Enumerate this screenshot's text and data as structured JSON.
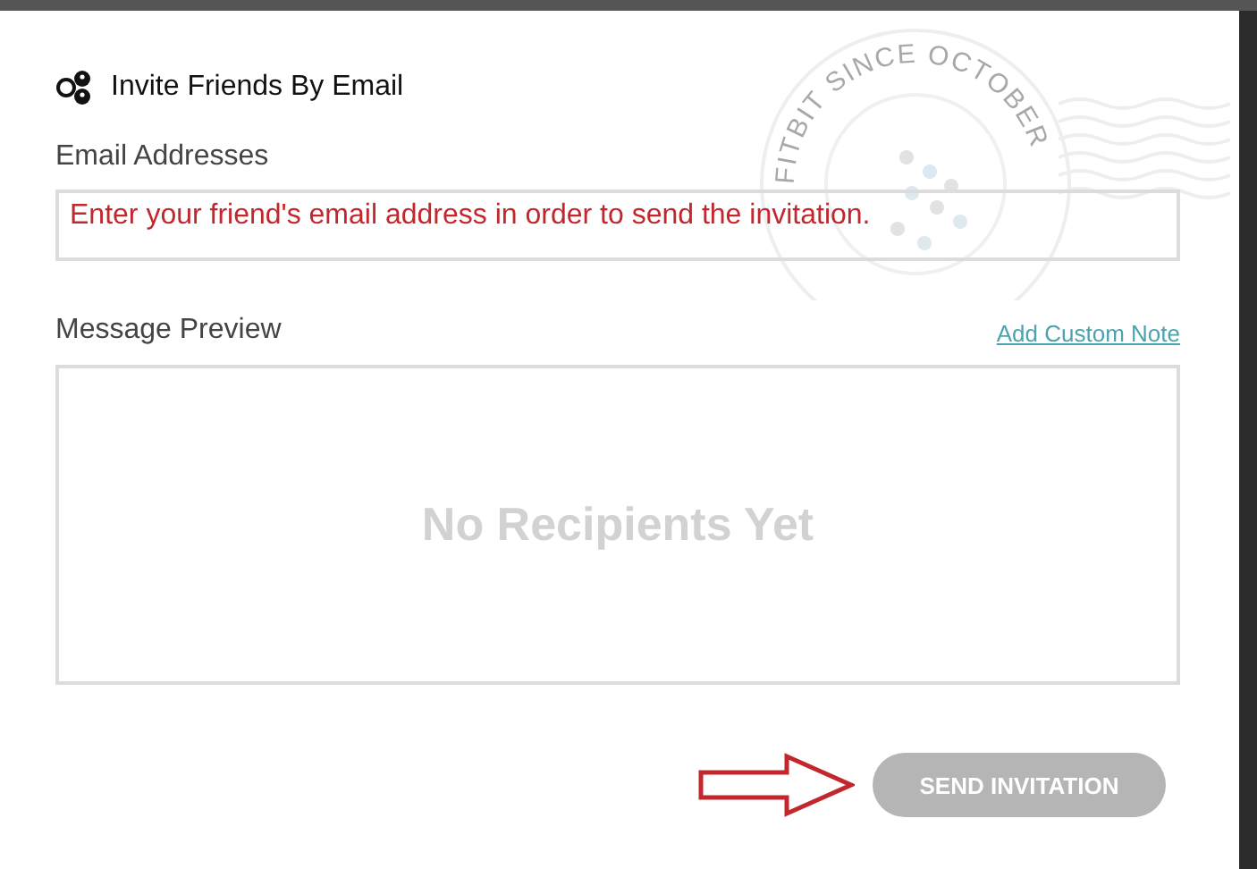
{
  "dialog": {
    "title": "Invite Friends By Email",
    "email": {
      "label": "Email Addresses",
      "error": "Enter your friend's email address in order to send the invitation."
    },
    "stamp": {
      "text": "FITBIT SINCE OCTOBER"
    },
    "preview": {
      "label": "Message Preview",
      "link": "Add Custom Note",
      "empty_text": "No Recipients Yet"
    },
    "send_button": {
      "label": "SEND INVITATION",
      "disabled": true
    }
  }
}
